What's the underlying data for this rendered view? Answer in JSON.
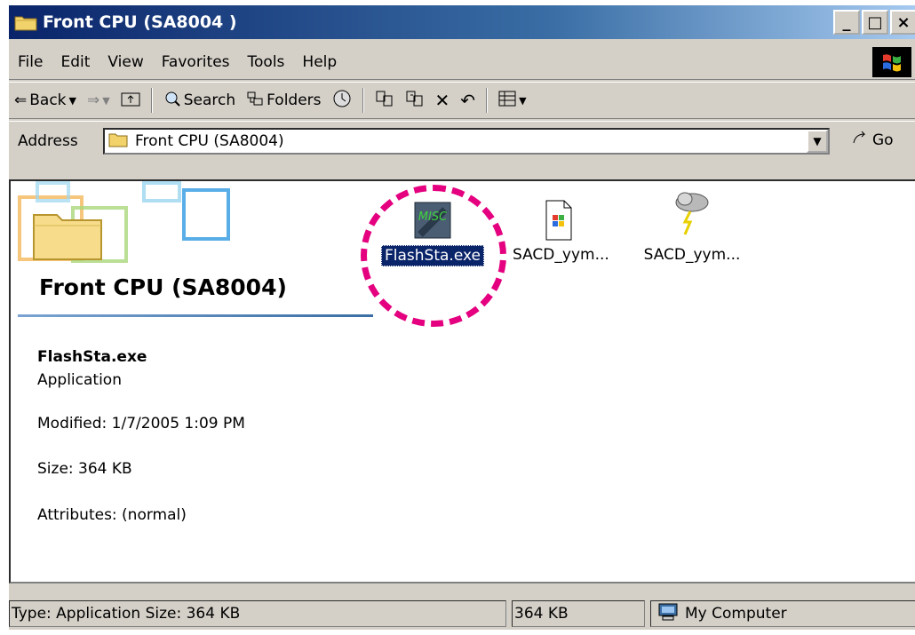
{
  "window": {
    "title": "Front CPU (SA8004 )",
    "controls": {
      "minimize": "_",
      "maximize": "□",
      "close": "×"
    }
  },
  "menu": [
    "File",
    "Edit",
    "View",
    "Favorites",
    "Tools",
    "Help"
  ],
  "toolbar": {
    "back_label": "Back",
    "search_label": "Search",
    "folders_label": "Folders"
  },
  "address": {
    "label": "Address",
    "value": "Front CPU (SA8004)",
    "go_label": "Go"
  },
  "content": {
    "folder_title": "Front CPU (SA8004)",
    "details": {
      "name": "FlashSta.exe",
      "type": "Application",
      "modified": "Modified: 1/7/2005 1:09 PM",
      "size": "Size: 364 KB",
      "attributes": "Attributes: (normal)"
    },
    "files": [
      {
        "label": "FlashSta.exe",
        "icon": "application-icon",
        "selected": true
      },
      {
        "label": "SACD_yym...",
        "icon": "setup-icon",
        "selected": false
      },
      {
        "label": "SACD_yym...",
        "icon": "weather-icon",
        "selected": false
      }
    ]
  },
  "status": {
    "type_size": "Type: Application Size: 364 KB",
    "size": "364 KB",
    "zone": "My Computer"
  },
  "colors": {
    "highlight": "#e4007f",
    "title_bar": "#0a246a",
    "selection": "#0a246a"
  }
}
